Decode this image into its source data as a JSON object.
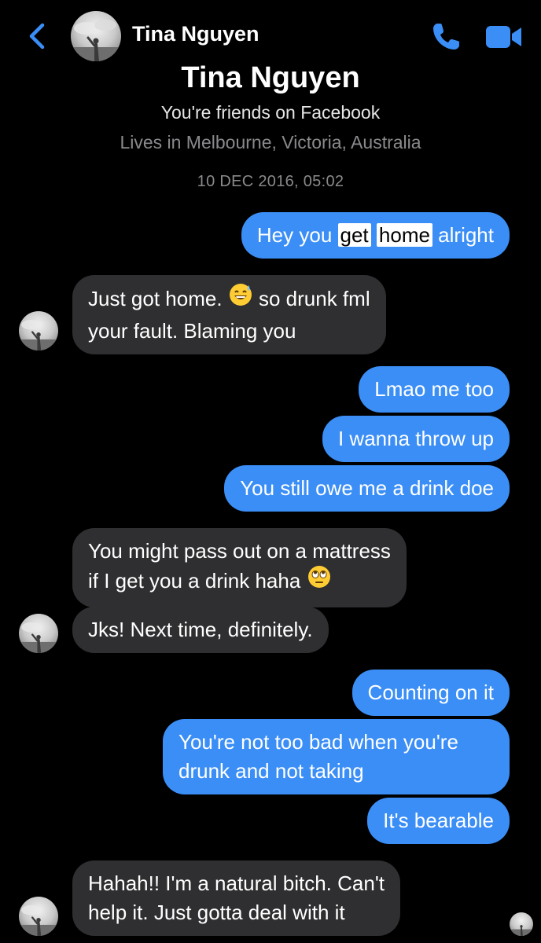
{
  "header": {
    "contact_name": "Tina Nguyen",
    "back_icon": "chevron-left-icon",
    "call_icon": "phone-icon",
    "video_icon": "video-camera-icon",
    "accent_color": "#3a8ef6"
  },
  "profile": {
    "name": "Tina Nguyen",
    "subtitle": "You're friends on Facebook",
    "location": "Lives in Melbourne, Victoria, Australia"
  },
  "timestamp": "10 DEC 2016, 05:02",
  "messages": {
    "m1": {
      "pre": "Hey you ",
      "hl1": "get",
      "mid": " ",
      "hl2": "home",
      "post": " alright"
    },
    "m2": {
      "line1_a": "Just got home. ",
      "emoji": "grinning-sweat-emoji",
      "line1_b": " so drunk fml",
      "line2": "your fault. Blaming you"
    },
    "m3": "Lmao me too",
    "m4": "I wanna throw up",
    "m5": "You still owe me a drink doe",
    "m6": {
      "line1": "You might pass out on a mattress",
      "line2": "if I get you a drink haha ",
      "emoji": "eye-roll-emoji"
    },
    "m7": "Jks! Next time, definitely.",
    "m8": "Counting on it",
    "m9": {
      "line1": "You're not too bad when you're",
      "line2": "drunk and not taking"
    },
    "m10": "It's bearable",
    "m11": {
      "line1": "Hahah!! I'm a natural bitch. Can't",
      "line2": "help it. Just gotta deal with it"
    }
  },
  "colors": {
    "outgoing_bubble": "#3a8ef6",
    "incoming_bubble": "#2f2f31",
    "background": "#000000"
  }
}
